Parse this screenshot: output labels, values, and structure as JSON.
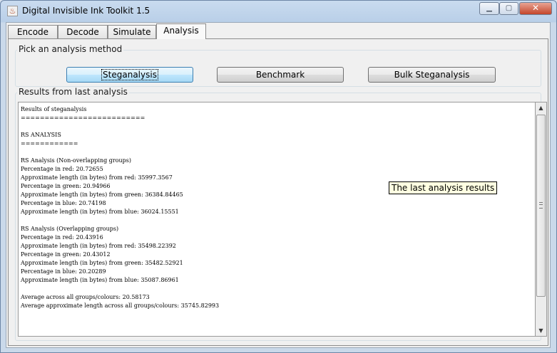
{
  "window": {
    "title": "Digital Invisible Ink Toolkit 1.5",
    "controls": {
      "minimize": "▁",
      "maximize": "▢",
      "close": "✕"
    }
  },
  "tabs": [
    {
      "label": "Encode",
      "active": false
    },
    {
      "label": "Decode",
      "active": false
    },
    {
      "label": "Simulate",
      "active": false
    },
    {
      "label": "Analysis",
      "active": true
    }
  ],
  "method_group": {
    "title": "Pick an analysis method",
    "buttons": {
      "steganalysis": "Steganalysis",
      "benchmark": "Benchmark",
      "bulk": "Bulk Steganalysis"
    }
  },
  "results_group": {
    "title": "Results from last analysis",
    "text": "Results of steganalysis\n==========================\n\nRS ANALYSIS\n============\n\nRS Analysis (Non-overlapping groups)\nPercentage in red: 20.72655\nApproximate length (in bytes) from red: 35997.3567\nPercentage in green: 20.94966\nApproximate length (in bytes) from green: 36384.84465\nPercentage in blue: 20.74198\nApproximate length (in bytes) from blue: 36024.15551\n\nRS Analysis (Overlapping groups)\nPercentage in red: 20.43916\nApproximate length (in bytes) from red: 35498.22392\nPercentage in green: 20.43012\nApproximate length (in bytes) from green: 35482.52921\nPercentage in blue: 20.20289\nApproximate length (in bytes) from blue: 35087.86961\n\nAverage across all groups/colours: 20.58173\nAverage approximate length across all groups/colours: 35745.82993",
    "tooltip": "The last analysis results"
  },
  "icons": {
    "app": "java-app-icon",
    "scroll_up": "scroll-up-arrow-icon",
    "scroll_down": "scroll-down-arrow-icon",
    "grip": "scroll-grip-icon"
  },
  "colors": {
    "titlebar": "#b9cfe8",
    "close_button": "#c4452b",
    "focus_button": "#bee6fd",
    "tooltip_bg": "#ffffe1"
  }
}
